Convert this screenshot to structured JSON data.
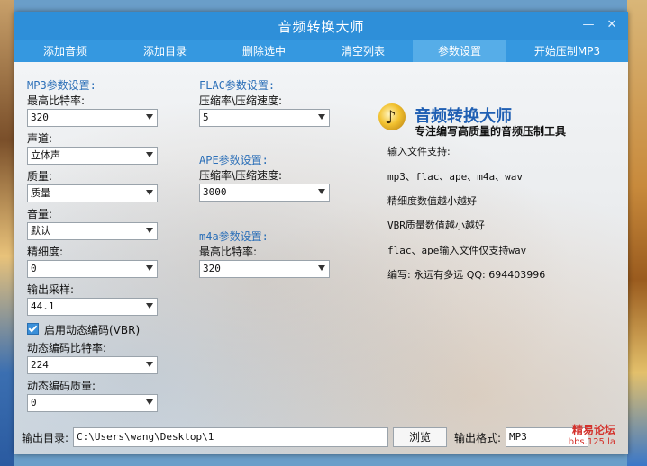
{
  "window": {
    "title": "音频转换大师",
    "minimize_glyph": "—",
    "close_glyph": "✕"
  },
  "tabs": [
    "添加音频",
    "添加目录",
    "删除选中",
    "清空列表",
    "参数设置",
    "开始压制MP3"
  ],
  "active_tab": "参数设置",
  "mp3": {
    "title": "MP3参数设置:",
    "max_bitrate_label": "最高比特率:",
    "max_bitrate": "320",
    "channel_label": "声道:",
    "channel": "立体声",
    "quality_label": "质量:",
    "quality": "质量",
    "volume_label": "音量:",
    "volume": "默认",
    "precision_label": "精细度:",
    "precision": "0",
    "sample_label": "输出采样:",
    "sample": "44.1",
    "vbr_label": "启用动态编码(VBR)",
    "vbr_checked": true,
    "vbr_bitrate_label": "动态编码比特率:",
    "vbr_bitrate": "224",
    "vbr_quality_label": "动态编码质量:",
    "vbr_quality": "0"
  },
  "flac": {
    "title": "FLAC参数设置:",
    "level_label": "压缩率\\压缩速度:",
    "level": "5"
  },
  "ape": {
    "title": "APE参数设置:",
    "level_label": "压缩率\\压缩速度:",
    "level": "3000"
  },
  "m4a": {
    "title": "m4a参数设置:",
    "bitrate_label": "最高比特率:",
    "bitrate": "320"
  },
  "info": {
    "app_name": "音频转换大师",
    "tagline": "专注编写高质量的音频压制工具",
    "lines": [
      "输入文件支持:",
      "mp3、flac、ape、m4a、wav",
      "精细度数值越小越好",
      "VBR质量数值越小越好",
      "flac、ape输入文件仅支持wav",
      "编写: 永远有多远 QQ: 694403996"
    ]
  },
  "output": {
    "dir_label": "输出目录:",
    "dir_value": "C:\\Users\\wang\\Desktop\\1",
    "browse_label": "浏览",
    "format_label": "输出格式:",
    "format_value": "MP3"
  },
  "watermark": {
    "line1": "精易论坛",
    "line2": "bbs.125.la"
  },
  "colors": {
    "titlebar": "#2e8fd9",
    "menubar": "#3598e0",
    "group_title": "#2b6fb8",
    "watermark": "#d4322c"
  }
}
